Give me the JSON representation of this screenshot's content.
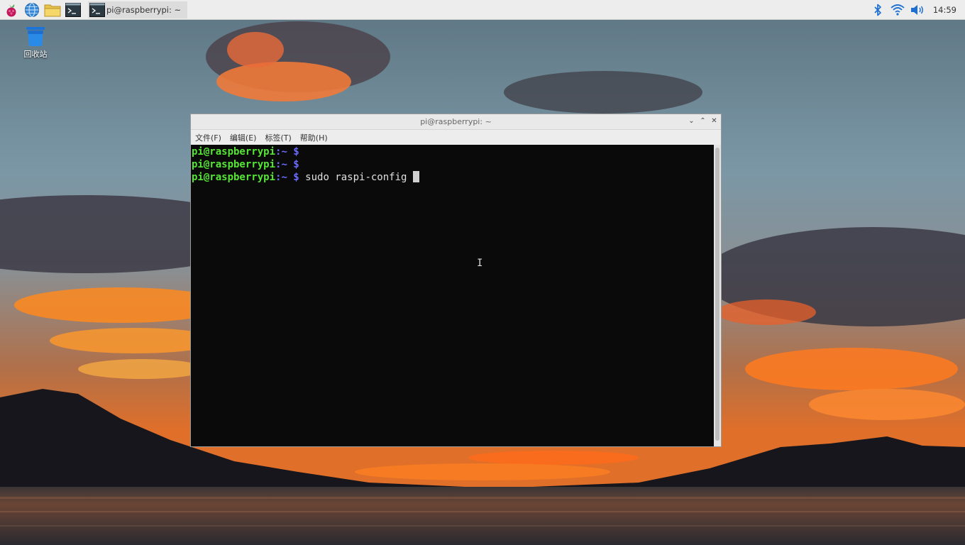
{
  "desktop": {
    "trash_label": "回收站"
  },
  "panel": {
    "launchers": [
      "raspberry-menu-icon",
      "web-browser-icon",
      "file-manager-icon",
      "terminal-icon"
    ],
    "task_button_label": "pi@raspberrypi: ~",
    "clock": "14:59",
    "tray_icons": [
      "bluetooth-icon",
      "wifi-icon",
      "volume-icon"
    ]
  },
  "terminal": {
    "title": "pi@raspberrypi: ~",
    "menu": [
      "文件(F)",
      "编辑(E)",
      "标签(T)",
      "帮助(H)"
    ],
    "lines": [
      {
        "user": "pi@raspberrypi",
        "path": ":~",
        "prompt": " $",
        "command": ""
      },
      {
        "user": "pi@raspberrypi",
        "path": ":~",
        "prompt": " $",
        "command": ""
      },
      {
        "user": "pi@raspberrypi",
        "path": ":~",
        "prompt": " $",
        "command": " sudo raspi-config "
      }
    ]
  },
  "colors": {
    "prompt_user": "#55e635",
    "prompt_path": "#6b6bff",
    "terminal_bg": "#0a0a0a",
    "panel_bg": "#ededed"
  }
}
